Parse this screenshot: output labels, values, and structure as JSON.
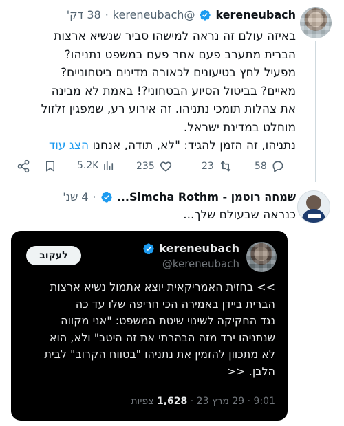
{
  "tweet": {
    "author_name": "kereneubach",
    "handle": "@kereneubach",
    "time": "38 דק'",
    "dot": "·",
    "body_lines": [
      "באיזה עולם זה נראה למישהו סביר שנשיא ארצות",
      "הברית מתערב פעם אחר פעם במשפט נתניהו?",
      "מפעיל לחץ בטיעונים לכאורה מדינים ביטחוניים?",
      "מאיים? בביטול הסיוע הבטחוני?! באמת לא מבינה",
      "את צהלות תומכי נתניהו. זה אירוע רע, שמפגין זלזול",
      "מוחלט במדינת ישראל."
    ],
    "last_line_text": "נתניהו, זה הזמן להגיד: \"לא, תודה, אנחנו",
    "show_more": "הצג עוד",
    "actions": {
      "replies": "58",
      "retweets": "23",
      "likes": "235",
      "views": "5.2K"
    }
  },
  "reply": {
    "author_name": "שמחה רוטמן - Simcha Rothm...",
    "time": "4 שנ'",
    "dot": "·",
    "body": "כנראה שבעולם שלך...",
    "quote": {
      "name": "kereneubach",
      "handle": "@kereneubach",
      "follow_label": "לעקוב",
      "body_lines": [
        ">> בחזית האמריקאית יוצא אתמול נשיא ארצות",
        "הברית ביידן באמירה הכי חריפה שלו עד כה",
        "נגד החקיקה לשינוי שיטת המשפט: \"אני מקווה",
        "שנתניהו ירד מזה הבהרתי את זה היטב\" ולא, הוא",
        "לא מתכוון להזמין את נתניהו \"בטווח הקרוב\" לבית",
        "הלבן. <<"
      ],
      "meta_time": "9:01 · 29 מרץ 23 ·",
      "meta_views_count": "1,628",
      "meta_views_label": "צפיות"
    }
  },
  "colors": {
    "accent": "#1d9bf0",
    "muted": "#536471",
    "text": "#0f1419",
    "quote_bg": "#000000"
  },
  "icons": [
    "verified-badge-icon",
    "share-icon",
    "bookmark-icon",
    "views-icon",
    "like-icon",
    "retweet-icon",
    "reply-icon"
  ]
}
